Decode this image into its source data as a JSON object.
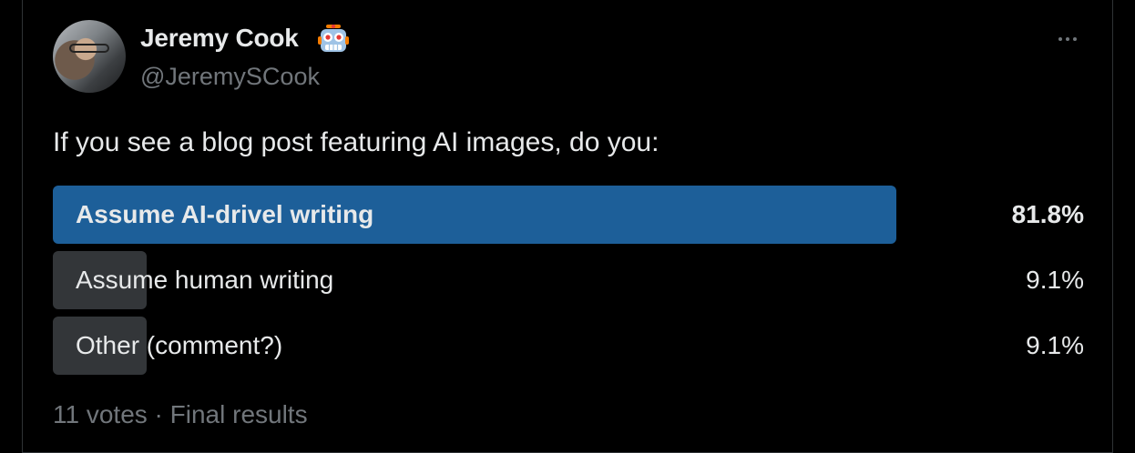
{
  "author": {
    "name": "Jeremy Cook",
    "emoji_icon": "robot-face-icon",
    "handle": "@JeremySCook"
  },
  "poll": {
    "question": "If you see a blog post featuring AI images, do you:",
    "options": [
      {
        "label": "Assume AI-drivel writing",
        "percent_text": "81.8%",
        "share": 0.818,
        "winner": true
      },
      {
        "label": "Assume human writing",
        "percent_text": "9.1%",
        "share": 0.091,
        "winner": false
      },
      {
        "label": "Other (comment?)",
        "percent_text": "9.1%",
        "share": 0.091,
        "winner": false
      }
    ],
    "footer": "11 votes · Final results"
  },
  "colors": {
    "background": "#000000",
    "winner_bar": "#1d5f99",
    "other_bar": "#333639",
    "muted_text": "#71767b"
  }
}
